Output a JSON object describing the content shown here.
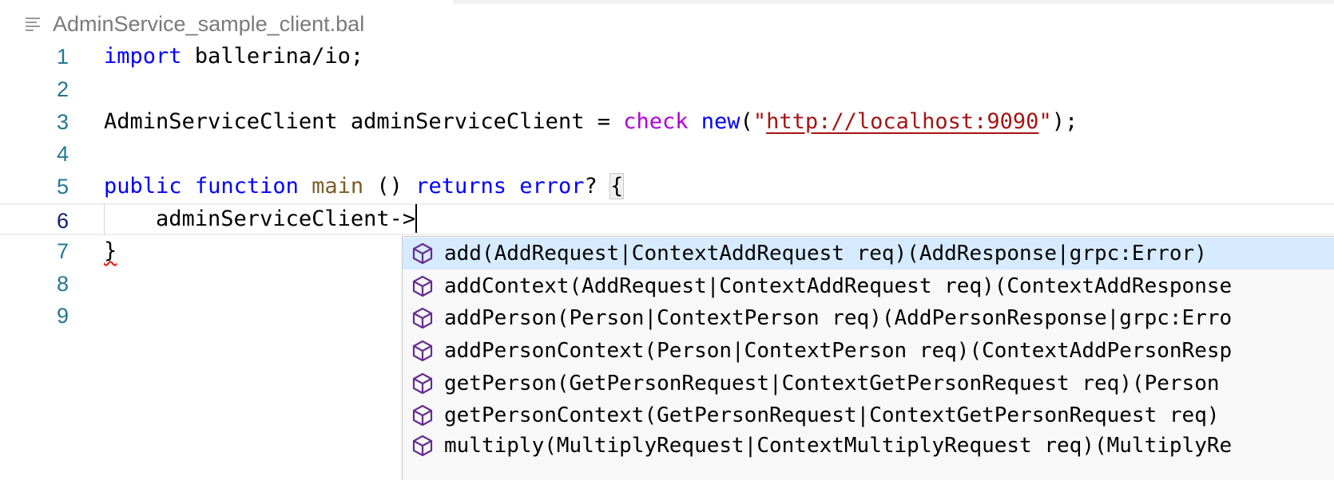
{
  "breadcrumb": {
    "file_name": "AdminService_sample_client.bal",
    "icon": "file-outline-icon"
  },
  "editor": {
    "line_numbers": [
      "1",
      "2",
      "3",
      "4",
      "5",
      "6",
      "7",
      "8",
      "9"
    ],
    "lines": {
      "l1": {
        "kw_import": "import",
        "rest": " ballerina/io;"
      },
      "l3": {
        "decl": "AdminServiceClient adminServiceClient = ",
        "kw_check": "check",
        "space": " ",
        "kw_new": "new",
        "open": "(",
        "quote1": "\"",
        "url": "http://localhost:9090",
        "quote2": "\"",
        "close": ");"
      },
      "l5": {
        "kw_public": "public",
        "kw_function": "function",
        "fn_main": "main",
        "parens": " () ",
        "kw_returns": "returns",
        "kw_error": "error",
        "q": "? ",
        "brace": "{"
      },
      "l6": {
        "text": "    adminServiceClient->"
      },
      "l7": {
        "brace": "}"
      }
    }
  },
  "suggest": {
    "icon": "method-cube-icon",
    "accent_color": "#652d90",
    "items": [
      "add(AddRequest|ContextAddRequest req)(AddResponse|grpc:Error)",
      "addContext(AddRequest|ContextAddRequest req)(ContextAddResponse",
      "addPerson(Person|ContextPerson req)(AddPersonResponse|grpc:Erro",
      "addPersonContext(Person|ContextPerson req)(ContextAddPersonResp",
      "getPerson(GetPersonRequest|ContextGetPersonRequest req)(Person",
      "getPersonContext(GetPersonRequest|ContextGetPersonRequest req)",
      "multiply(MultiplyRequest|ContextMultiplyRequest req)(MultiplyRe"
    ]
  }
}
